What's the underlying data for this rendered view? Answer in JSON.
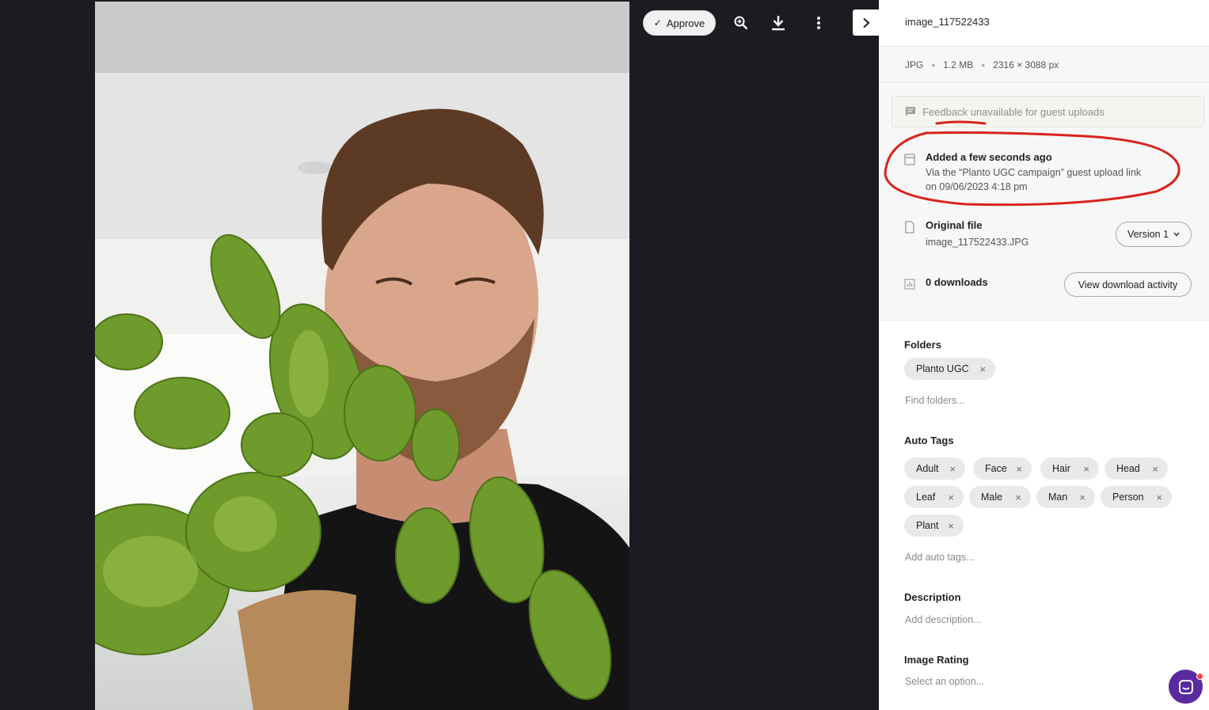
{
  "toolbar": {
    "approve_label": "Approve",
    "icons": [
      "zoom-in-icon",
      "download-icon",
      "more-vertical-icon",
      "chevron-right-icon"
    ]
  },
  "panel": {
    "file_name": "image_117522433",
    "meta": {
      "format": "JPG",
      "size": "1.2 MB",
      "dimensions": "2316 × 3088 px"
    },
    "feedback_notice": "Feedback unavailable for guest uploads",
    "added": {
      "title": "Added a few seconds ago",
      "line1": "Via the “Planto UGC campaign” guest upload link",
      "line2": "on 09/06/2023 4:18 pm"
    },
    "original_file": {
      "title": "Original file",
      "file_name": "image_117522433.JPG",
      "version_label": "Version 1"
    },
    "downloads": {
      "title": "0 downloads",
      "button_label": "View download activity"
    },
    "folders": {
      "title": "Folders",
      "chips": [
        "Planto UGC"
      ],
      "placeholder": "Find folders..."
    },
    "auto_tags": {
      "title": "Auto Tags",
      "chips": [
        "Adult",
        "Face",
        "Hair",
        "Head",
        "Leaf",
        "Male",
        "Man",
        "Person",
        "Plant"
      ],
      "placeholder": "Add auto tags..."
    },
    "description": {
      "title": "Description",
      "placeholder": "Add description..."
    },
    "image_rating": {
      "title": "Image Rating",
      "placeholder": "Select an option..."
    }
  },
  "colors": {
    "viewer_bg": "#1c1b22",
    "annotation_red": "#d9231c",
    "chat_purple": "#5a2aa0"
  }
}
